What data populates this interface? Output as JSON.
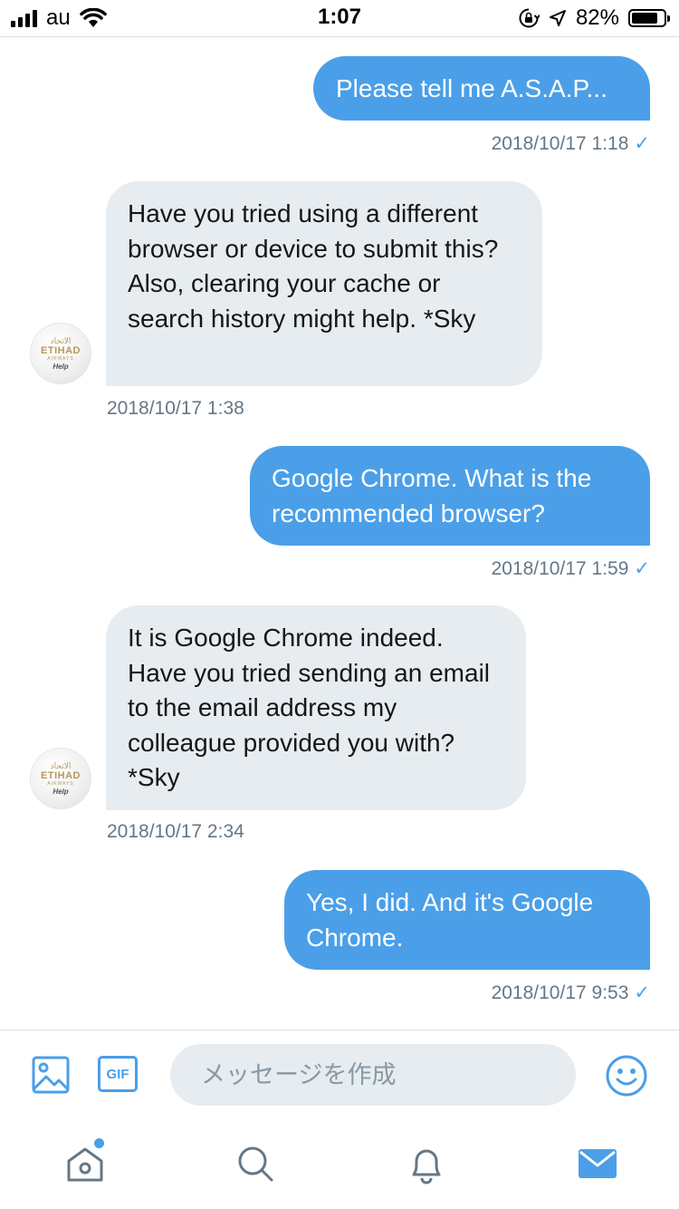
{
  "status_bar": {
    "carrier": "au",
    "time": "1:07",
    "battery_percent": "82%",
    "battery_level": 0.82,
    "icons": [
      "cellular-signal-icon",
      "wifi-icon",
      "orientation-lock-icon",
      "location-arrow-icon",
      "battery-icon"
    ]
  },
  "conversation": {
    "messages": [
      {
        "direction": "sent",
        "text": "Please tell me A.S.A.P...",
        "timestamp": "2018/10/17 1:18",
        "read_check": "✓"
      },
      {
        "direction": "received",
        "text": "Have you tried using a different browser or device to submit this? Also, clearing your cache or search history might help. *Sky",
        "timestamp": "2018/10/17 1:38"
      },
      {
        "direction": "sent",
        "text": "Google Chrome. What is the recommended browser?",
        "timestamp": "2018/10/17 1:59",
        "read_check": "✓"
      },
      {
        "direction": "received",
        "text": "It is Google Chrome indeed. Have you tried sending an email to the email address my colleague provided you with? *Sky",
        "timestamp": "2018/10/17 2:34"
      },
      {
        "direction": "sent",
        "text": "Yes, I did. And it's Google Chrome.",
        "timestamp": "2018/10/17 9:53",
        "read_check": "✓"
      }
    ]
  },
  "avatar": {
    "arabic": "الاتحاد",
    "brand": "ETIHAD",
    "sub": "AIRWAYS",
    "help": "Help"
  },
  "composer": {
    "gif_label": "GIF",
    "placeholder": "メッセージを作成",
    "value": "",
    "icons": [
      "image-icon",
      "gif-icon",
      "emoji-icon"
    ]
  },
  "tab_bar": {
    "tabs": [
      "home-tab",
      "search-tab",
      "notifications-tab",
      "messages-tab"
    ],
    "active": "messages-tab",
    "home_has_new": true
  },
  "colors": {
    "accent": "#4a9fe8",
    "received_bubble": "#e6ecf0",
    "timestamp": "#657786"
  }
}
